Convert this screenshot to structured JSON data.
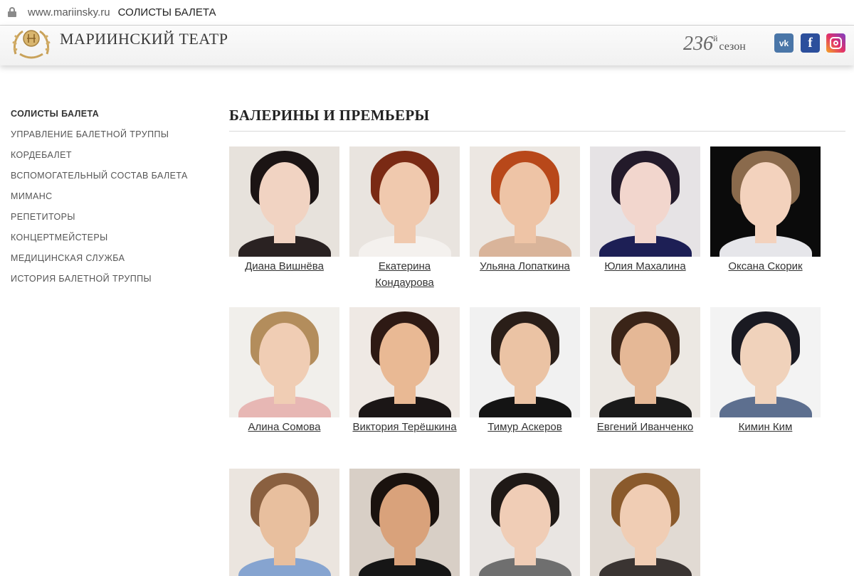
{
  "browser": {
    "url_host": "www.mariinsky.ru",
    "page_title": "СОЛИСТЫ БАЛЕТА"
  },
  "header": {
    "brand": "МАРИИНСКИЙ ТЕАТР",
    "season_number": "236",
    "season_suffix": "й",
    "season_word": "сезон",
    "social": {
      "vk": "vk",
      "fb": "f"
    }
  },
  "sidebar": {
    "items": [
      {
        "label": "СОЛИСТЫ БАЛЕТА",
        "active": true
      },
      {
        "label": "УПРАВЛЕНИЕ БАЛЕТНОЙ ТРУППЫ",
        "active": false
      },
      {
        "label": "КОРДЕБАЛЕТ",
        "active": false
      },
      {
        "label": "ВСПОМОГАТЕЛЬНЫЙ СОСТАВ БАЛЕТА",
        "active": false
      },
      {
        "label": "МИМАНС",
        "active": false
      },
      {
        "label": "РЕПЕТИТОРЫ",
        "active": false
      },
      {
        "label": "КОНЦЕРТМЕЙСТЕРЫ",
        "active": false
      },
      {
        "label": "МЕДИЦИНСКАЯ СЛУЖБА",
        "active": false
      },
      {
        "label": "ИСТОРИЯ БАЛЕТНОЙ ТРУППЫ",
        "active": false
      }
    ]
  },
  "main": {
    "section_title": "БАЛЕРИНЫ И ПРЕМЬЕРЫ",
    "artists": [
      {
        "name_line1": "Диана Вишнёва",
        "name_line2": "",
        "bg": "#e7e2dc",
        "skin": "#f1d3c2",
        "hair": "#1b1414",
        "cloth": "#2a2222"
      },
      {
        "name_line1": "Екатерина",
        "name_line2": "Кондаурова",
        "bg": "#e9e4df",
        "skin": "#f0c9ae",
        "hair": "#7a2a14",
        "cloth": "#f4f1ee"
      },
      {
        "name_line1": "Ульяна Лопаткина",
        "name_line2": "",
        "bg": "#ece7e2",
        "skin": "#eec4a6",
        "hair": "#b8481a",
        "cloth": "#d9b49a"
      },
      {
        "name_line1": "Юлия Махалина",
        "name_line2": "",
        "bg": "#e6e3e5",
        "skin": "#f2d6cd",
        "hair": "#231a2a",
        "cloth": "#1d1f55"
      },
      {
        "name_line1": "Оксана Скорик",
        "name_line2": "",
        "bg": "#0b0b0b",
        "skin": "#f3d2bd",
        "hair": "#8a6a4c",
        "cloth": "#e6e6ea"
      },
      {
        "name_line1": "Алина Сомова",
        "name_line2": "",
        "bg": "#f1efeb",
        "skin": "#f0cdb4",
        "hair": "#b38d5c",
        "cloth": "#e7b7b4"
      },
      {
        "name_line1": "Виктория Терёшкина",
        "name_line2": "",
        "bg": "#efe9e4",
        "skin": "#e9b994",
        "hair": "#2e1a14",
        "cloth": "#1b1616"
      },
      {
        "name_line1": "Тимур Аскеров",
        "name_line2": "",
        "bg": "#f1f1f1",
        "skin": "#ebc3a4",
        "hair": "#2a1e18",
        "cloth": "#141414"
      },
      {
        "name_line1": "Евгений Иванченко",
        "name_line2": "",
        "bg": "#ece8e3",
        "skin": "#e5b896",
        "hair": "#3a2418",
        "cloth": "#1a1a1a"
      },
      {
        "name_line1": "Кимин Ким",
        "name_line2": "",
        "bg": "#f3f3f3",
        "skin": "#f0d2bb",
        "hair": "#1a1a22",
        "cloth": "#5d6f8f"
      },
      {
        "name_line1": "",
        "name_line2": "",
        "bg": "#ebe5df",
        "skin": "#e8bf9e",
        "hair": "#8a6040",
        "cloth": "#86a4d0"
      },
      {
        "name_line1": "",
        "name_line2": "",
        "bg": "#d8cfc6",
        "skin": "#d9a27b",
        "hair": "#1a120e",
        "cloth": "#161616"
      },
      {
        "name_line1": "",
        "name_line2": "",
        "bg": "#e9e5e2",
        "skin": "#f0cdb6",
        "hair": "#1f1916",
        "cloth": "#6f6f6f"
      },
      {
        "name_line1": "",
        "name_line2": "",
        "bg": "#e1dad3",
        "skin": "#f0cdb4",
        "hair": "#8a5a2c",
        "cloth": "#3a3432"
      }
    ]
  }
}
